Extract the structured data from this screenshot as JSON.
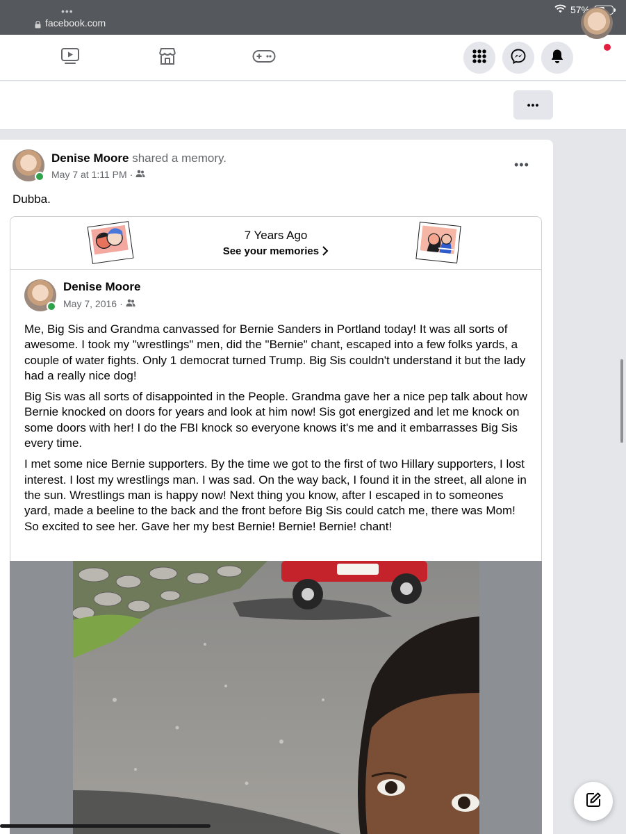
{
  "browser": {
    "dots": "•••",
    "url": "facebook.com",
    "battery_percent_label": "57%",
    "battery_level": 0.57
  },
  "nav": {
    "tabs": [
      "watch-icon",
      "marketplace-icon",
      "gaming-icon"
    ],
    "actions": [
      "menu-grid-icon",
      "messenger-icon",
      "notifications-icon"
    ]
  },
  "sub_bar": {
    "more_label": "•••"
  },
  "post": {
    "author": "Denise Moore",
    "action": "shared a memory.",
    "timestamp": "May 7 at 1:11 PM",
    "separator": "·",
    "text": "Dubba.",
    "menu": "•••"
  },
  "memory": {
    "title": "7 Years Ago",
    "link": "See your memories",
    "inner_author": "Denise Moore",
    "inner_date": "May 7, 2016",
    "separator": "·",
    "paragraphs": [
      "Me, Big Sis and Grandma canvassed for Bernie Sanders in Portland today! It was all sorts of awesome. I took my \"wrestlings\" men, did the \"Bernie\" chant, escaped into a few folks yards, a couple of water fights. Only 1 democrat turned Trump. Big Sis couldn't understand it but the lady had a really nice dog!",
      "Big Sis was all sorts of disappointed in the People. Grandma gave her a nice pep talk about how Bernie knocked on doors for years and look at him now! Sis got energized and let me knock on some doors with her! I do the FBI knock so everyone knows it's me and it embarrasses Big Sis every time.",
      "I met some nice Bernie supporters. By the time we got to the first of two Hillary supporters, I lost interest. I lost my wrestlings man. I was sad. On the way back, I found it in the street, all alone in the sun. Wrestlings man is happy now! Next thing you know, after I escaped in to someones yard, made a beeline to the back and the front before Big Sis could catch me, there was Mom! So excited to see her. Gave her my best Bernie! Bernie! Bernie! chant!"
    ]
  },
  "colors": {
    "fb_blue": "#1877f2",
    "online_green": "#31a24c",
    "notification_red": "#e41e3f"
  }
}
